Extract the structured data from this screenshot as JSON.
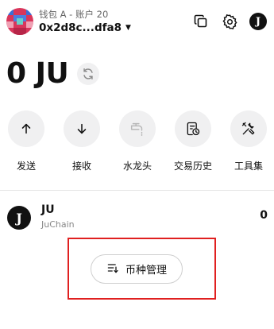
{
  "header": {
    "wallet_name": "钱包 A - 账户 20",
    "address": "0x2d8c...dfa8",
    "icons": [
      "copy-icon",
      "gear-icon",
      "ju-logo-icon"
    ],
    "logo_letter": "J"
  },
  "balance": {
    "amount": "0 JU",
    "refresh_icon": "refresh-icon"
  },
  "actions": [
    {
      "label": "发送",
      "icon": "arrow-up-icon"
    },
    {
      "label": "接收",
      "icon": "arrow-down-icon"
    },
    {
      "label": "水龙头",
      "icon": "faucet-icon"
    },
    {
      "label": "交易历史",
      "icon": "history-icon"
    },
    {
      "label": "工具集",
      "icon": "tools-icon"
    }
  ],
  "token": {
    "logo_letter": "J",
    "symbol": "JU",
    "chain": "JuChain",
    "amount": "0"
  },
  "manage": {
    "label": "币种管理",
    "icon": "list-filter-icon"
  },
  "colors": {
    "highlight": "#e02020",
    "circle_bg": "#f0f0f1"
  }
}
